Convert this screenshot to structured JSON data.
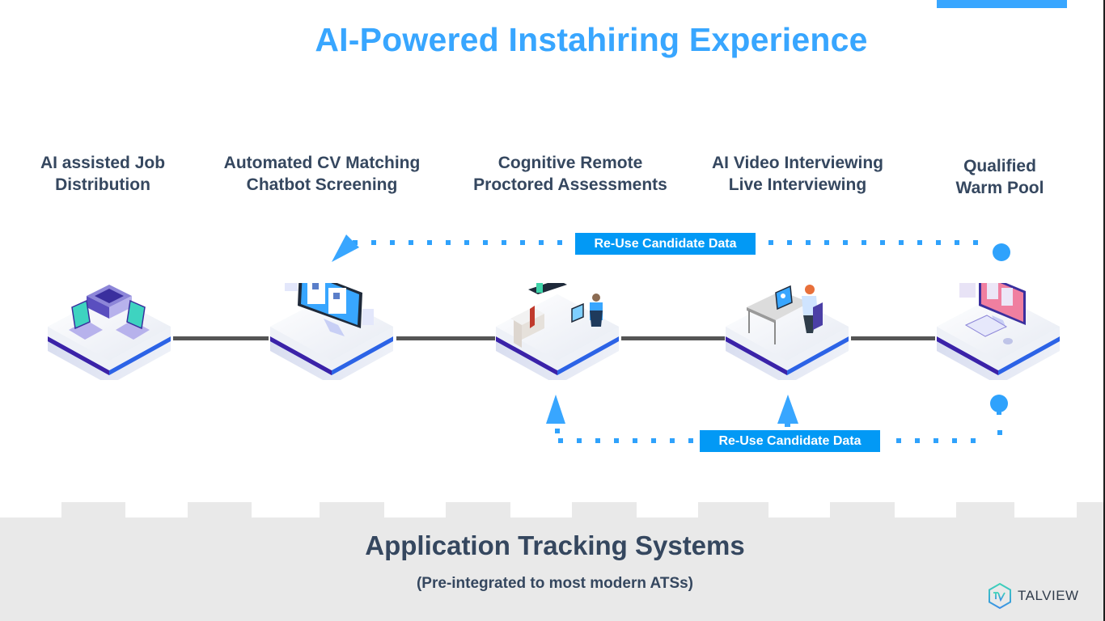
{
  "title": "AI-Powered Instahiring Experience",
  "steps": [
    {
      "label_line1": "AI assisted Job",
      "label_line2": "Distribution",
      "icon": "servers-laptops-icon"
    },
    {
      "label_line1": "Automated CV Matching",
      "label_line2": "Chatbot Screening",
      "icon": "cv-monitor-icon"
    },
    {
      "label_line1": "Cognitive Remote",
      "label_line2": "Proctored Assessments",
      "icon": "assessment-people-icon"
    },
    {
      "label_line1": "AI Video Interviewing",
      "label_line2": "Live Interviewing",
      "icon": "video-interview-desk-icon"
    },
    {
      "label_line1": "Qualified",
      "label_line2": "Warm Pool",
      "icon": "talent-pool-monitor-icon"
    }
  ],
  "loops": {
    "top_label": "Re-Use Candidate Data",
    "bottom_label": "Re-Use Candidate Data"
  },
  "ats": {
    "title": "Application Tracking Systems",
    "subtitle": "(Pre-integrated to most modern ATSs)"
  },
  "logo": {
    "text": "TALVIEW"
  },
  "colors": {
    "accent": "#38a6ff",
    "badge": "#0299f5",
    "text": "#35475f",
    "ats_bg": "#e9e9e9"
  }
}
